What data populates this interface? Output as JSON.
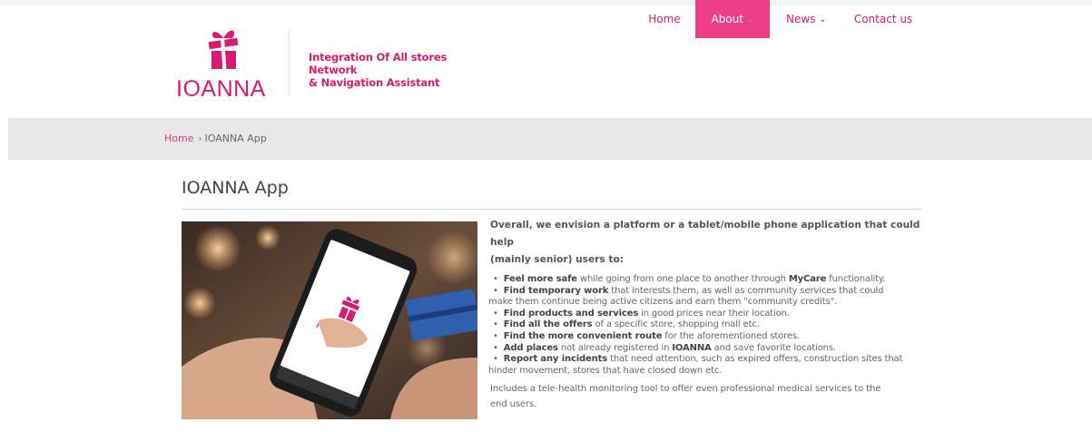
{
  "brand": {
    "name": "IOANNA",
    "tagline_line1": "Integration Of All stores Network",
    "tagline_line2": "& Navigation Assistant",
    "accent_color": "#d91a72"
  },
  "nav": {
    "items": [
      {
        "label": "Home",
        "active": false,
        "has_dropdown": false
      },
      {
        "label": "About",
        "active": true,
        "has_dropdown": true
      },
      {
        "label": "News",
        "active": false,
        "has_dropdown": true
      },
      {
        "label": "Contact us",
        "active": false,
        "has_dropdown": false
      }
    ],
    "caret_glyph": "⌄"
  },
  "breadcrumb": {
    "home": "Home",
    "separator": "›",
    "current": "IOANNA App"
  },
  "page": {
    "title": "IOANNA App",
    "image_alt_icon": "phone-app-photo"
  },
  "content": {
    "intro_line1": "Overall, we envision a platform or a tablet/mobile phone application that could help",
    "intro_line2": "(mainly senior) users to:",
    "bullet": "•",
    "items": [
      {
        "strong": "Feel more safe",
        "rest1": " while going from one place to another through ",
        "strong2": "MyCare",
        "rest2": " functionality."
      },
      {
        "strong": "Find temporary work",
        "rest1": " that interests them, as well as community services that could",
        "line2": "make them continue being active citizens and earn them \"community credits\"."
      },
      {
        "strong": "Find products and services",
        "rest1": " in good prices near their location."
      },
      {
        "strong": "Find all the offers",
        "rest1": " of a specific store, shopping mall etc."
      },
      {
        "strong": "Find the more convenient route",
        "rest1": " for the aforementioned stores."
      },
      {
        "strong": "Add places",
        "rest1": " not already registered in ",
        "strong2": "IOANNA",
        "rest2": " and save favorite locations."
      },
      {
        "strong": "Report any incidents",
        "rest1": " that need attention, such as expired offers, construction sites that",
        "line2": "hinder movement, stores that have closed down etc."
      }
    ],
    "outro_line1": "Includes a tele-health monitoring tool to offer even professional medical services to the",
    "outro_line2": "end users."
  }
}
